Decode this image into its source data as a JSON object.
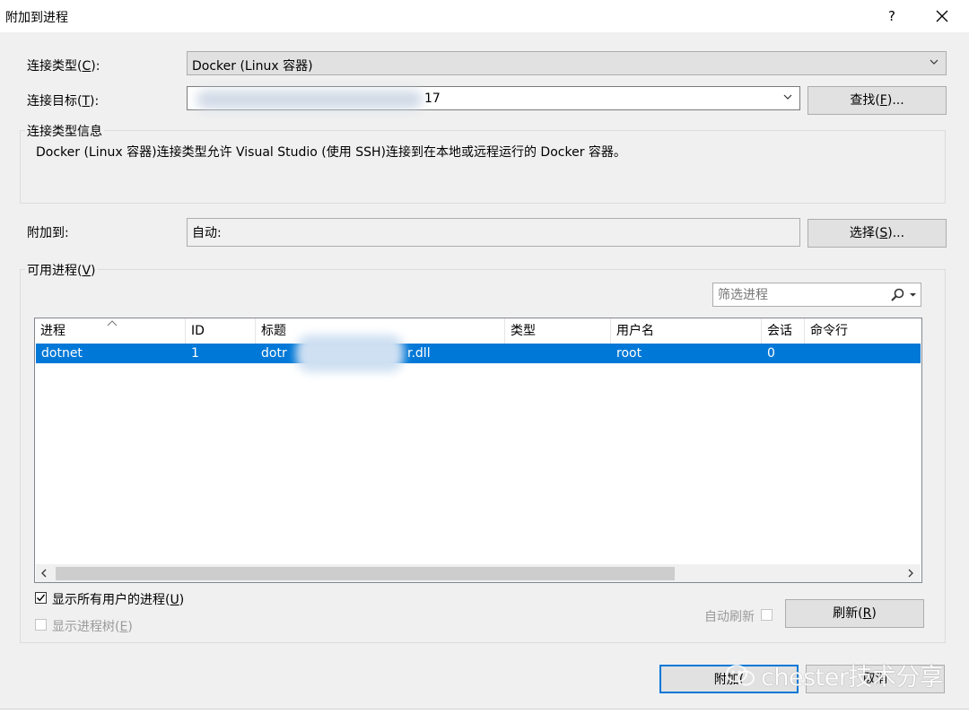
{
  "window": {
    "title": "附加到进程",
    "help_glyph": "?",
    "close_glyph": "✕"
  },
  "connection_type": {
    "label_prefix": "连接类型(",
    "mnemonic": "C",
    "label_suffix": "):",
    "value": "Docker (Linux 容器)"
  },
  "connection_target": {
    "label_prefix": "连接目标(",
    "mnemonic": "T",
    "label_suffix": "):",
    "value_suffix": "17"
  },
  "find_button": {
    "prefix": "查找(",
    "mnemonic": "F",
    "suffix": ")..."
  },
  "info_group": {
    "title": "连接类型信息",
    "text": "Docker (Linux 容器)连接类型允许 Visual Studio (使用 SSH)连接到在本地或远程运行的 Docker 容器。"
  },
  "attach_to": {
    "label": "附加到:",
    "value": "自动:"
  },
  "select_button": {
    "prefix": "选择(",
    "mnemonic": "S",
    "suffix": ")..."
  },
  "processes_group": {
    "title_prefix": "可用进程(",
    "mnemonic": "V",
    "title_suffix": ")"
  },
  "filter": {
    "placeholder": "筛选进程"
  },
  "table": {
    "columns": [
      "进程",
      "ID",
      "标题",
      "类型",
      "用户名",
      "会话",
      "命令行"
    ],
    "rows": [
      {
        "process": "dotnet",
        "id": "1",
        "title_start": "dotr",
        "title_end": "r.dll",
        "type": "",
        "user": "root",
        "session": "0",
        "cmdline": ""
      }
    ]
  },
  "show_all_users": {
    "checked": true,
    "prefix": "显示所有用户的进程(",
    "mnemonic": "U",
    "suffix": ")"
  },
  "show_tree": {
    "checked": false,
    "prefix": "显示进程树(",
    "mnemonic": "E",
    "suffix": ")"
  },
  "auto_refresh": {
    "label": "自动刷新"
  },
  "refresh_button": {
    "prefix": "刷新(",
    "mnemonic": "R",
    "suffix": ")"
  },
  "attach_button": {
    "label": "附加("
  },
  "cancel_button": {
    "label": "取消"
  },
  "watermark": {
    "text": "chester技术分享"
  },
  "colors": {
    "selection": "#0078d7",
    "background": "#f0f0f0"
  }
}
